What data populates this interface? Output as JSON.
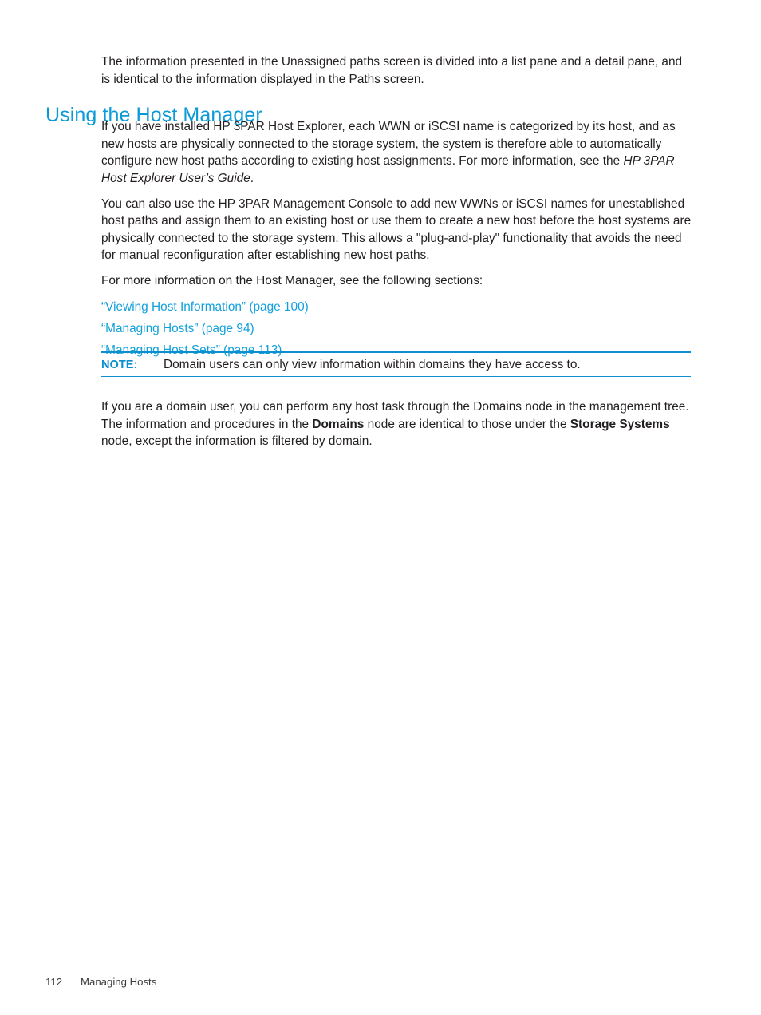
{
  "document": {
    "intro_paragraph": "The information presented in the Unassigned paths screen is divided into a list pane and a detail pane, and is identical to the information displayed in the Paths screen.",
    "section_heading": "Using the Host Manager",
    "paragraph_1": {
      "text_before_italic": "If you have installed HP 3PAR Host Explorer, each WWN or iSCSI name is categorized by its host, and as new hosts are physically connected to the storage system, the system is therefore able to automatically configure new host paths according to existing host assignments. For more information, see the ",
      "italic_text": "HP 3PAR Host Explorer User’s Guide",
      "text_after_italic": "."
    },
    "paragraph_2": "You can also use the HP 3PAR Management Console to add new WWNs or iSCSI names for unestablished host paths and assign them to an existing host or use them to create a new host before the host systems are physically connected to the storage system. This allows a \"plug-and-play\" functionality that avoids the need for manual reconfiguration after establishing new host paths.",
    "paragraph_3": "For more information on the Host Manager, see the following sections:",
    "cross_reference_links": [
      "“Viewing Host Information” (page 100)",
      "“Managing Hosts” (page 94)",
      "“Managing Host Sets” (page 113)"
    ],
    "note": {
      "label": "NOTE:",
      "text": "Domain users can only view information within domains they have access to."
    },
    "closing_paragraph": {
      "segment_1": "If you are a domain user, you can perform any host task through the Domains node in the management tree. The information and procedures in the ",
      "bold_1": "Domains",
      "segment_2": " node are identical to those under the ",
      "bold_2": "Storage Systems",
      "segment_3": " node, except the information is filtered by domain."
    },
    "footer": {
      "page_number": "112",
      "chapter_title": "Managing Hosts"
    },
    "colors": {
      "heading_blue": "#0b9ad7",
      "link_blue": "#12a0db",
      "note_rule_blue": "#0b8fd0",
      "body_text": "#231f20",
      "page_background": "#ffffff"
    }
  }
}
